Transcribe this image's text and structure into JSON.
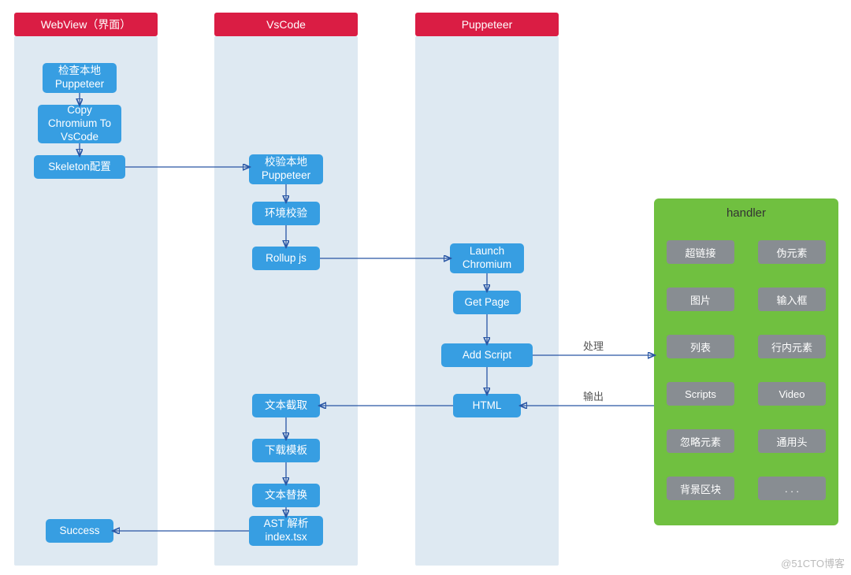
{
  "headers": {
    "webview": "WebView（界面）",
    "vscode": "VsCode",
    "puppeteer": "Puppeteer"
  },
  "nodes": {
    "check_local": "检查本地\nPuppeteer",
    "copy_chromium": "Copy\nChromium To\nVsCode",
    "skeleton_cfg": "Skeleton配置",
    "validate_local": "校验本地\nPuppeteer",
    "env_check": "环境校验",
    "rollup": "Rollup js",
    "launch": "Launch\nChromium",
    "get_page": "Get Page",
    "add_script": "Add Script",
    "html": "HTML",
    "text_trunc": "文本截取",
    "download_tpl": "下载模板",
    "text_replace": "文本替换",
    "ast_parse": "AST 解析\nindex.tsx",
    "success": "Success"
  },
  "handler": {
    "title": "handler",
    "tags": [
      "超链接",
      "伪元素",
      "图片",
      "输入框",
      "列表",
      "行内元素",
      "Scripts",
      "Video",
      "忽略元素",
      "通用头",
      "背景区块",
      ". . ."
    ]
  },
  "labels": {
    "process": "处理",
    "output": "输出"
  },
  "watermark": "@51CTO博客"
}
